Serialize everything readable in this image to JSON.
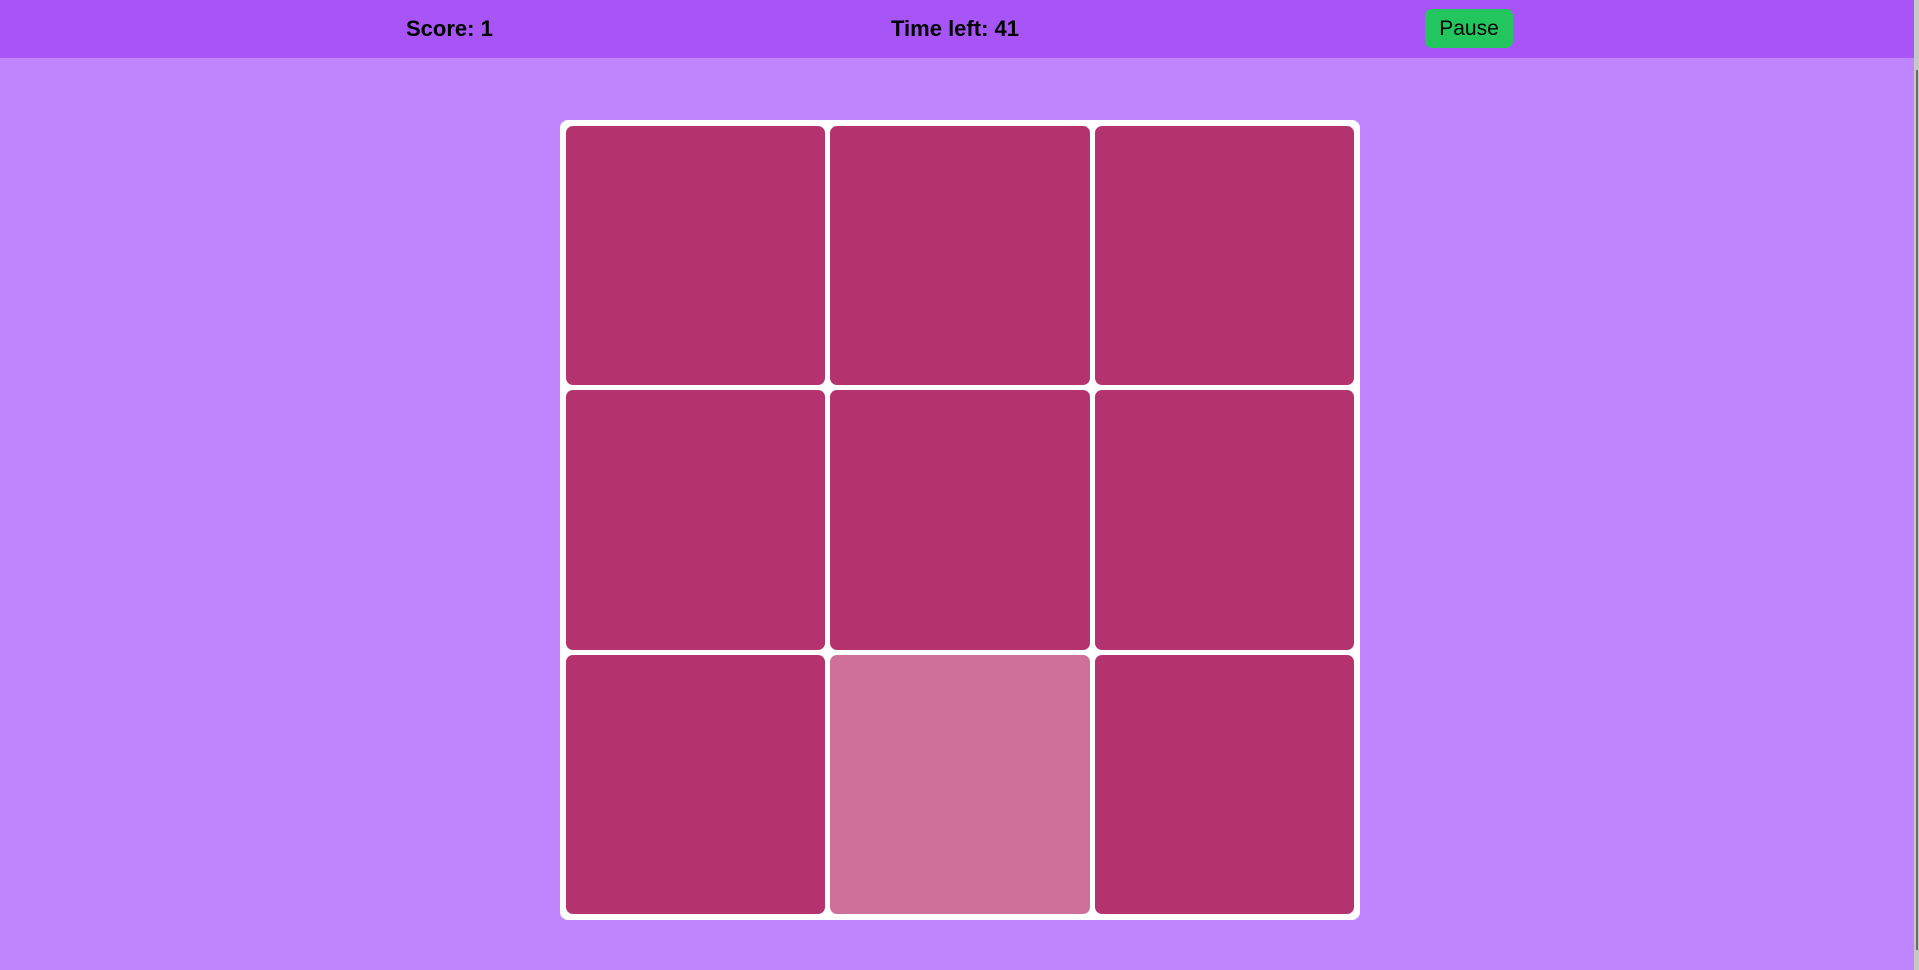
{
  "header": {
    "score_text": "Score: 1",
    "time_text": "Time left: 41",
    "pause_label": "Pause"
  },
  "colors": {
    "page_background": "#c084fc",
    "header_background": "#a855f7",
    "pause_button": "#22c55e",
    "tile_normal": "#b5336e",
    "tile_highlight": "#ce7097",
    "board_background": "#ffffff"
  },
  "grid": {
    "rows": 3,
    "columns": 3,
    "tiles": [
      {
        "state": "normal"
      },
      {
        "state": "normal"
      },
      {
        "state": "normal"
      },
      {
        "state": "normal"
      },
      {
        "state": "normal"
      },
      {
        "state": "normal"
      },
      {
        "state": "normal"
      },
      {
        "state": "highlight"
      },
      {
        "state": "normal"
      }
    ]
  }
}
